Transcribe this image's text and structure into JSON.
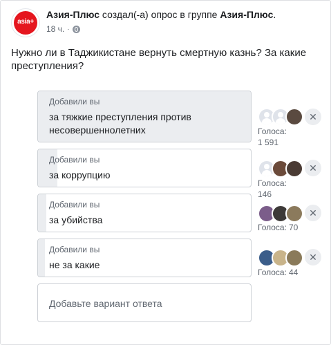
{
  "post": {
    "page_logo_text": "asia+",
    "author": "Азия-Плюс",
    "action": " создал(-а) опрос в группе ",
    "group": "Азия-Плюс",
    "time": "18 ч.",
    "separator": "·",
    "privacy_icon": "globe-icon",
    "question": "Нужно ли в Таджикистане вернуть смертную казнь? За какие преступления?"
  },
  "poll": {
    "options": [
      {
        "added": "Добавили вы",
        "text": "за тяжкие преступления против несовершеннолетних",
        "votes_label": "Голоса:",
        "votes": "1 591",
        "share": 1.0,
        "voter_colors": [
          "#dfe3ea",
          "#dfe3ea",
          "#5a4a40"
        ]
      },
      {
        "added": "Добавили вы",
        "text": "за коррупцию",
        "votes_label": "Голоса:",
        "votes": "146",
        "share": 0.09,
        "voter_colors": [
          "#dfe3ea",
          "#6b4a3a",
          "#4a3b34"
        ]
      },
      {
        "added": "Добавили вы",
        "text": "за убийства",
        "votes_label": "Голоса:",
        "votes": "70",
        "share": 0.04,
        "voter_colors": [
          "#7b5d8a",
          "#3d3a38",
          "#8b7a5c"
        ]
      },
      {
        "added": "Добавили вы",
        "text": "не за какие",
        "votes_label": "Голоса:",
        "votes": "44",
        "share": 0.03,
        "voter_colors": [
          "#3b5d8a",
          "#c9b48a",
          "#8a7a5a"
        ]
      }
    ],
    "add_placeholder": "Добавьте вариант ответа",
    "remove_symbol": "✕"
  }
}
